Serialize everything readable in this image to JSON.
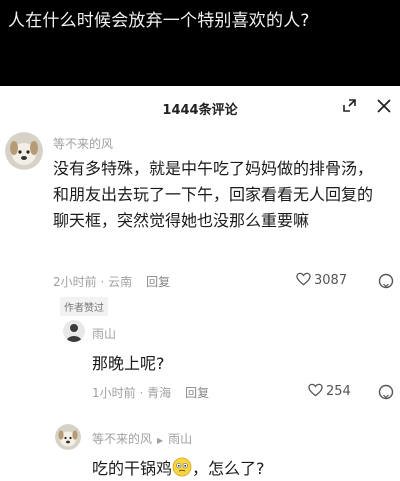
{
  "question_title": "人在什么时候会放弃一个特别喜欢的人?",
  "comments_header": {
    "count_label": "1444条评论",
    "expand_icon": "expand-icon",
    "close_icon": "close-icon"
  },
  "comments": [
    {
      "username": "等不来的风",
      "text": "没有多特殊，就是中午吃了妈妈做的排骨汤，和朋友出去玩了一下午，回家看看无人回复的聊天框，突然觉得她也没那么重要嘛",
      "time": "2小时前",
      "location": "云南",
      "reply_label": "回复",
      "likes": "3087",
      "author_liked": "作者赞过"
    },
    {
      "username": "雨山",
      "text": "那晚上呢?",
      "time": "1小时前",
      "location": "青海",
      "reply_label": "回复",
      "likes": "254"
    },
    {
      "username": "等不来的风",
      "reply_to": "雨山",
      "text_before": "吃的干锅鸡",
      "text_after": "，怎么了?"
    }
  ],
  "colors": {
    "top_bar": "#000000",
    "sheet": "#ffffff",
    "muted_text": "#a0a0a0"
  }
}
